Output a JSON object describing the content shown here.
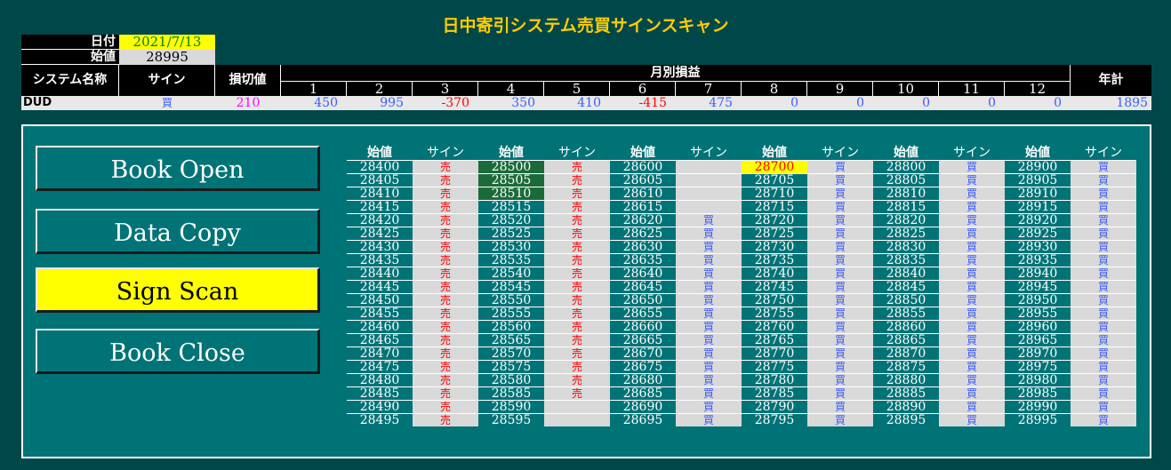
{
  "title": "日中寄引システム売買サインスキャン",
  "info": {
    "date_label": "日付",
    "date_value": "2021/7/13",
    "open_label": "始値",
    "open_value": "28995"
  },
  "summary": {
    "headers": {
      "system": "システム名称",
      "sign": "サイン",
      "stop": "損切値",
      "monthly": "月別損益",
      "annual": "年計"
    },
    "months": [
      "1",
      "2",
      "3",
      "4",
      "5",
      "6",
      "7",
      "8",
      "9",
      "10",
      "11",
      "12"
    ],
    "row": {
      "name": "DUD",
      "sign": "買",
      "stop": "210",
      "monthly": [
        "450",
        "995",
        "-370",
        "350",
        "410",
        "-415",
        "475",
        "0",
        "0",
        "0",
        "0",
        "0"
      ],
      "annual": "1895"
    }
  },
  "buttons": [
    "Book Open",
    "Data Copy",
    "Sign Scan",
    "Book Close"
  ],
  "active_button": "Sign Scan",
  "grid": {
    "value_header": "始値",
    "sign_header": "サイン",
    "columns": [
      {
        "values": [
          "28400",
          "28405",
          "28410",
          "28415",
          "28420",
          "28425",
          "28430",
          "28435",
          "28440",
          "28445",
          "28450",
          "28455",
          "28460",
          "28465",
          "28470",
          "28475",
          "28480",
          "28485",
          "28490",
          "28495"
        ],
        "signs": [
          "売",
          "売",
          "売",
          "売",
          "売",
          "売",
          "売",
          "売",
          "売",
          "売",
          "売",
          "売",
          "売",
          "売",
          "売",
          "売",
          "売",
          "売",
          "売",
          "売"
        ]
      },
      {
        "values": [
          "28500",
          "28505",
          "28510",
          "28515",
          "28520",
          "28525",
          "28530",
          "28535",
          "28540",
          "28545",
          "28550",
          "28555",
          "28560",
          "28565",
          "28570",
          "28575",
          "28580",
          "28585",
          "28590",
          "28595"
        ],
        "signs": [
          "売",
          "売",
          "売",
          "売",
          "売",
          "売",
          "売",
          "売",
          "売",
          "売",
          "売",
          "売",
          "売",
          "売",
          "売",
          "売",
          "売",
          "売",
          "",
          ""
        ]
      },
      {
        "values": [
          "28600",
          "28605",
          "28610",
          "28615",
          "28620",
          "28625",
          "28630",
          "28635",
          "28640",
          "28645",
          "28650",
          "28655",
          "28660",
          "28665",
          "28670",
          "28675",
          "28680",
          "28685",
          "28690",
          "28695"
        ],
        "signs": [
          "",
          "",
          "",
          "",
          "買",
          "買",
          "買",
          "買",
          "買",
          "買",
          "買",
          "買",
          "買",
          "買",
          "買",
          "買",
          "買",
          "買",
          "買",
          "買"
        ]
      },
      {
        "values": [
          "28700",
          "28705",
          "28710",
          "28715",
          "28720",
          "28725",
          "28730",
          "28735",
          "28740",
          "28745",
          "28750",
          "28755",
          "28760",
          "28765",
          "28770",
          "28775",
          "28780",
          "28785",
          "28790",
          "28795"
        ],
        "signs": [
          "買",
          "買",
          "買",
          "買",
          "買",
          "買",
          "買",
          "買",
          "買",
          "買",
          "買",
          "買",
          "買",
          "買",
          "買",
          "買",
          "買",
          "買",
          "買",
          "買"
        ]
      },
      {
        "values": [
          "28800",
          "28805",
          "28810",
          "28815",
          "28820",
          "28825",
          "28830",
          "28835",
          "28840",
          "28845",
          "28850",
          "28855",
          "28860",
          "28865",
          "28870",
          "28875",
          "28880",
          "28885",
          "28890",
          "28895"
        ],
        "signs": [
          "買",
          "買",
          "買",
          "買",
          "買",
          "買",
          "買",
          "買",
          "買",
          "買",
          "買",
          "買",
          "買",
          "買",
          "買",
          "買",
          "買",
          "買",
          "買",
          "買"
        ]
      },
      {
        "values": [
          "28900",
          "28905",
          "28910",
          "28915",
          "28920",
          "28925",
          "28930",
          "28935",
          "28940",
          "28945",
          "28950",
          "28955",
          "28960",
          "28965",
          "28970",
          "28975",
          "28980",
          "28985",
          "28990",
          "28995"
        ],
        "signs": [
          "買",
          "買",
          "買",
          "買",
          "買",
          "買",
          "買",
          "買",
          "買",
          "買",
          "買",
          "買",
          "買",
          "買",
          "買",
          "買",
          "買",
          "買",
          "買",
          "買"
        ]
      }
    ],
    "highlight_value": "28700",
    "dark_values": [
      "28500",
      "28505",
      "28510"
    ]
  },
  "colors": {
    "background": "#00474a",
    "panel": "#007377",
    "title": "#ffcc00",
    "sell": "#ff0000",
    "buy": "#3b5bff",
    "negative": "#ff0000",
    "positive": "#3b5bff",
    "stop": "#ff00ff",
    "highlight": "#ffff00"
  }
}
